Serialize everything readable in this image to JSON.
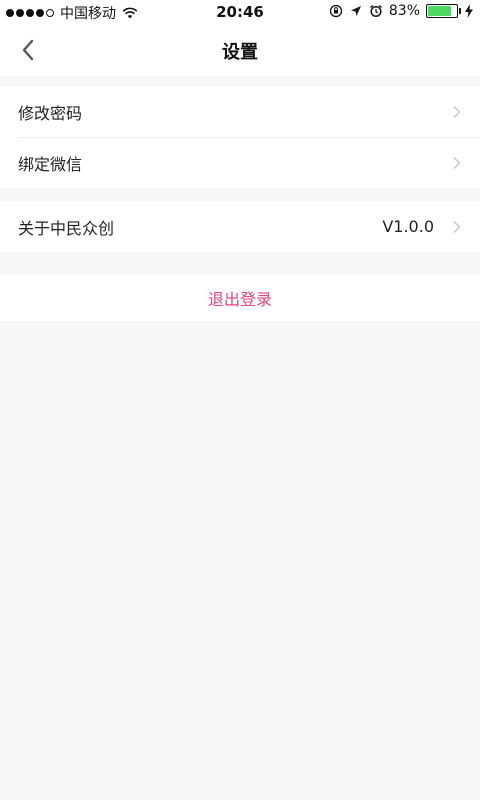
{
  "status_bar": {
    "carrier": "中国移动",
    "time": "20:46",
    "battery": "83%",
    "battery_level": 0.83,
    "battery_color": "#4cd964"
  },
  "navbar": {
    "title": "设置",
    "back_icon": "chevron-left-icon"
  },
  "groups": [
    {
      "items": [
        {
          "label": "修改密码"
        },
        {
          "label": "绑定微信"
        }
      ]
    },
    {
      "items": [
        {
          "label": "关于中民众创",
          "value": "V1.0.0"
        }
      ]
    }
  ],
  "logout": {
    "label": "退出登录",
    "color": "#e6447e"
  },
  "colors": {
    "background": "#f7f7f7",
    "surface": "#ffffff",
    "divider": "#ececec",
    "chevron": "#c7c7cc"
  }
}
